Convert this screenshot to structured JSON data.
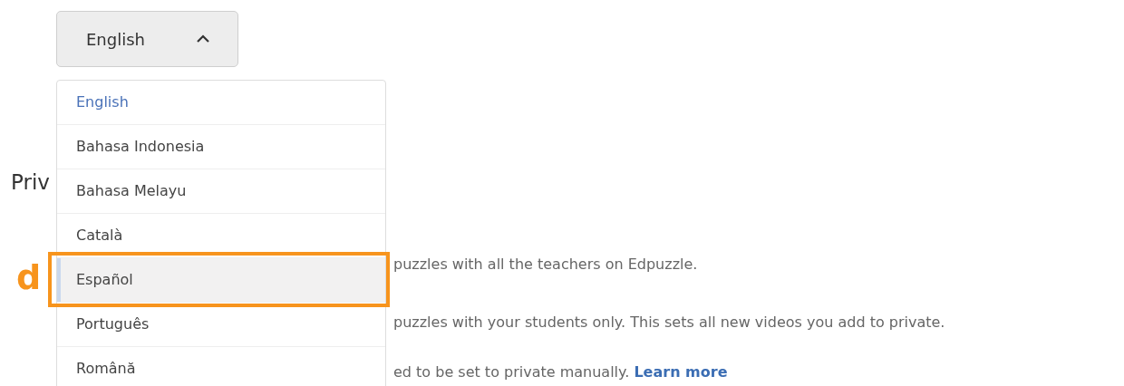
{
  "language_select": {
    "value": "English",
    "expanded": true
  },
  "language_menu": [
    {
      "label": "English",
      "selected": true,
      "highlighted": false
    },
    {
      "label": "Bahasa Indonesia",
      "selected": false,
      "highlighted": false
    },
    {
      "label": "Bahasa Melayu",
      "selected": false,
      "highlighted": false
    },
    {
      "label": "Català",
      "selected": false,
      "highlighted": false
    },
    {
      "label": "Español",
      "selected": false,
      "highlighted": true
    },
    {
      "label": "Português",
      "selected": false,
      "highlighted": false
    },
    {
      "label": "Română",
      "selected": false,
      "highlighted": false
    }
  ],
  "section_heading": "Priv",
  "paragraphs": [
    {
      "text": "puzzles with all the teachers on Edpuzzle."
    },
    {
      "text": "puzzles with your students only. This sets all new videos you add to private."
    },
    {
      "text": "ed to be set to private manually.",
      "link": "Learn more"
    }
  ],
  "annotation": {
    "label": "d"
  }
}
